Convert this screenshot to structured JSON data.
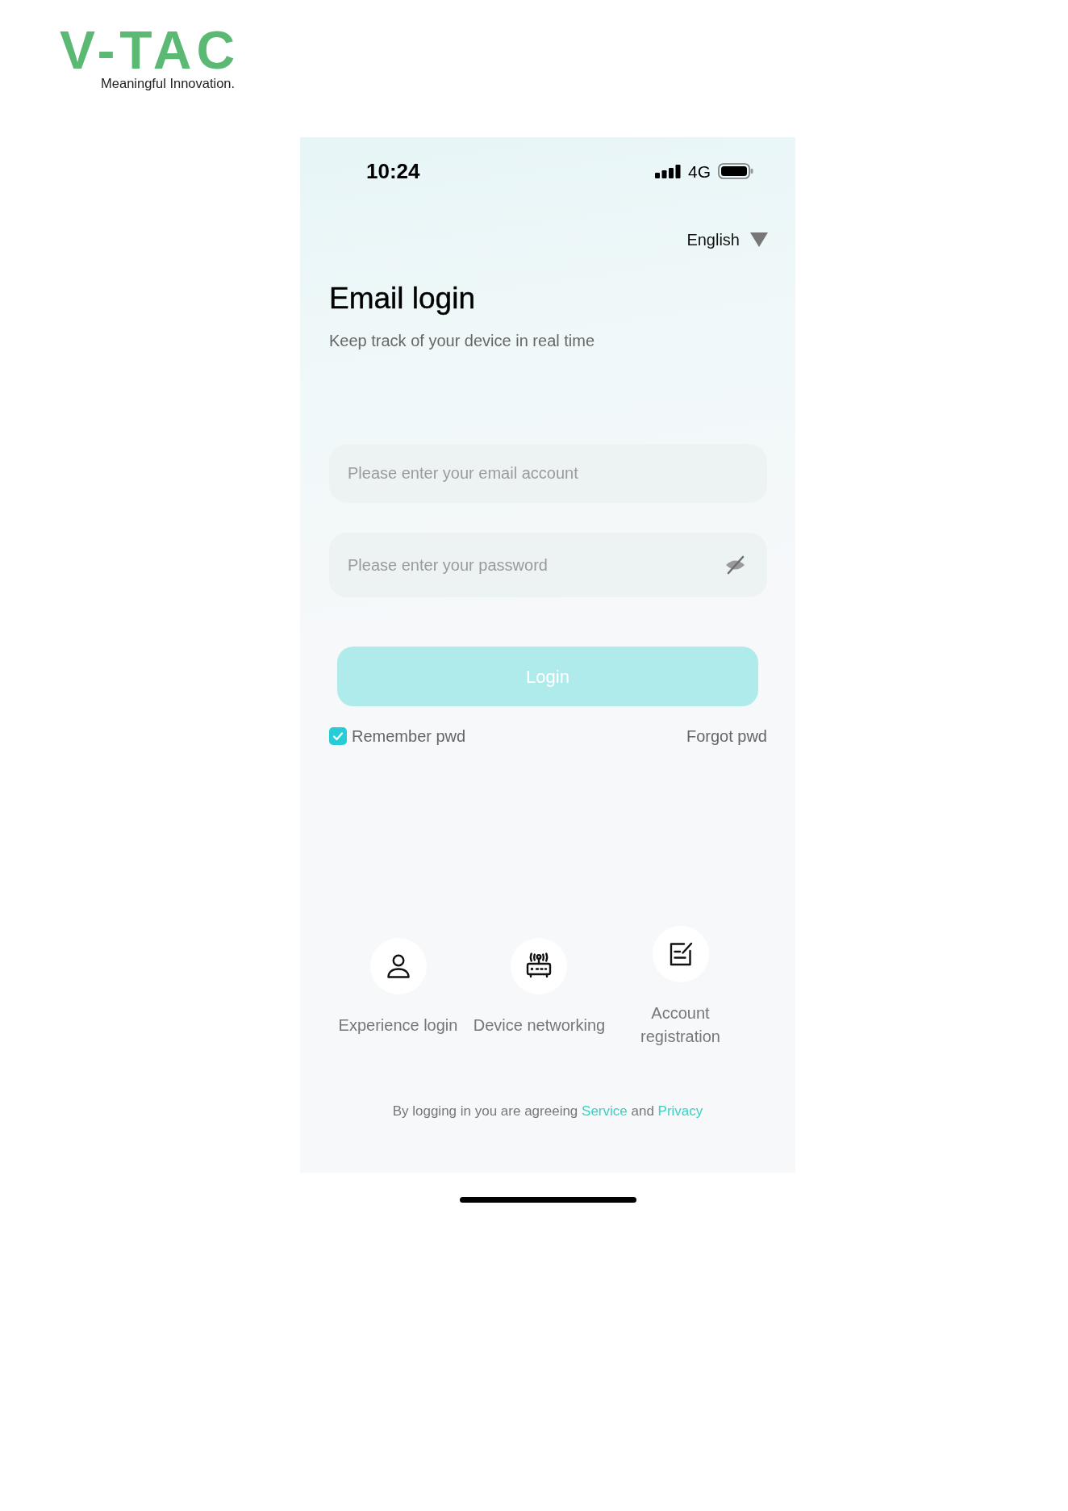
{
  "brand": {
    "name": "V-TAC",
    "tagline": "Meaningful Innovation."
  },
  "status_bar": {
    "time": "10:24",
    "network": "4G"
  },
  "language": {
    "label": "English"
  },
  "header": {
    "title": "Email login",
    "subtitle": "Keep track of your device in real time"
  },
  "fields": [
    {
      "kind": "email",
      "placeholder": "Please enter your email account"
    },
    {
      "kind": "password",
      "placeholder": "Please enter your password",
      "masked": true
    }
  ],
  "login_button": {
    "label": "Login",
    "disabled": true
  },
  "remember": {
    "label": "Remember pwd",
    "checked": true
  },
  "forgot": {
    "label": "Forgot pwd"
  },
  "shortcuts": [
    {
      "kind": "person",
      "label": "Experience login"
    },
    {
      "kind": "router",
      "label": "Device networking"
    },
    {
      "kind": "note",
      "label": "Account registration"
    }
  ],
  "agreement": [
    {
      "kind": "text",
      "text": "By logging in you are agreeing"
    },
    {
      "kind": "link",
      "text": "Service"
    },
    {
      "kind": "text",
      "text": "and"
    },
    {
      "kind": "link",
      "text": "Privacy"
    }
  ]
}
